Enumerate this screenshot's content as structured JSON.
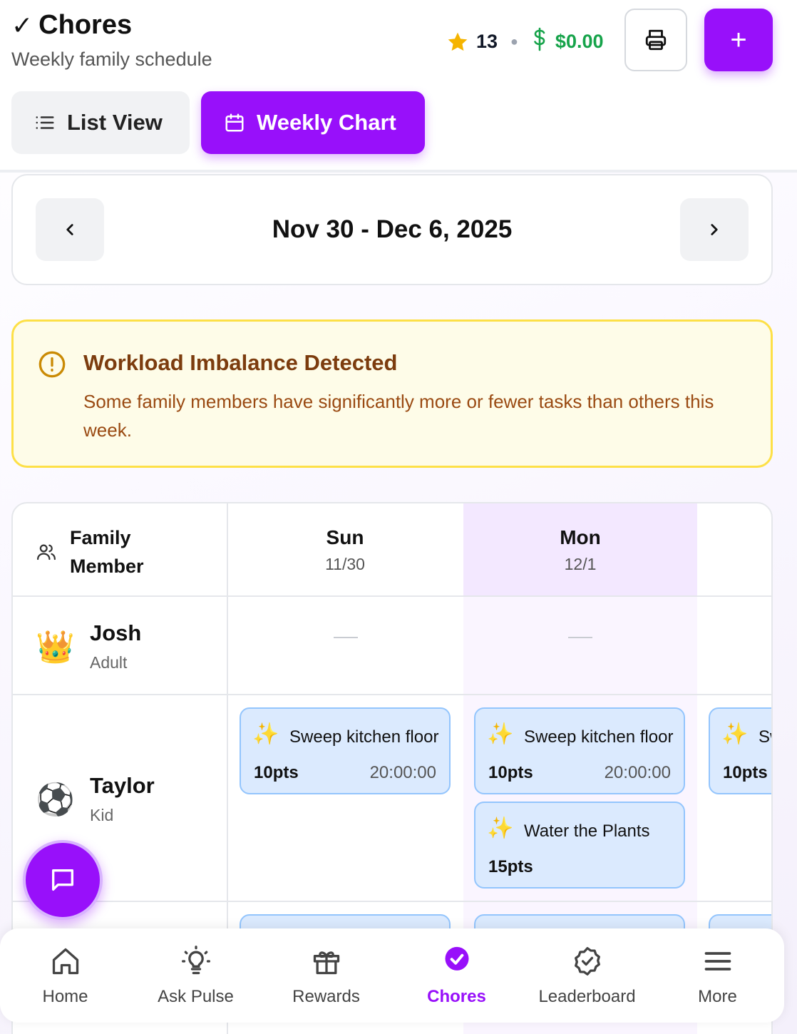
{
  "header": {
    "title": "Chores",
    "title_check": "✓",
    "subtitle": "Weekly family schedule",
    "points": "13",
    "money": "$0.00",
    "add_label": "+"
  },
  "view_toggle": {
    "list_label": "List View",
    "chart_label": "Weekly Chart",
    "active": "Weekly Chart"
  },
  "week": {
    "label": "Nov 30 - Dec 6, 2025"
  },
  "alert": {
    "title": "Workload Imbalance Detected",
    "message": "Some family members have significantly more or fewer tasks than others this week."
  },
  "grid": {
    "member_header": "Family Member",
    "days": [
      {
        "day": "Sun",
        "date": "11/30"
      },
      {
        "day": "Mon",
        "date": "12/1"
      }
    ],
    "members": [
      {
        "name": "Josh",
        "role": "Adult",
        "avatar": "👑"
      },
      {
        "name": "Taylor",
        "role": "Kid",
        "avatar": "⚽"
      }
    ],
    "tasks": {
      "taylor_sun_1": {
        "icon": "✨",
        "name": "Sweep kitchen floor",
        "points": "10pts",
        "time": "20:00:00"
      },
      "taylor_mon_1": {
        "icon": "✨",
        "name": "Sweep kitchen floor",
        "points": "10pts",
        "time": "20:00:00"
      },
      "taylor_mon_2": {
        "icon": "✨",
        "name": "Water the Plants",
        "points": "15pts"
      },
      "taylor_tue_1": {
        "icon": "✨",
        "name": "Sweep kitchen floor",
        "points": "10pts"
      }
    }
  },
  "bottom_nav": [
    {
      "label": "Home",
      "icon": "home-icon"
    },
    {
      "label": "Ask Pulse",
      "icon": "lightbulb-icon"
    },
    {
      "label": "Rewards",
      "icon": "gift-icon"
    },
    {
      "label": "Chores",
      "icon": "check-circle-icon",
      "active": true
    },
    {
      "label": "Leaderboard",
      "icon": "badge-check-icon"
    },
    {
      "label": "More",
      "icon": "menu-icon"
    }
  ],
  "colors": {
    "accent": "#9810fa",
    "money": "#16a34a",
    "alert_bg": "#fefce8",
    "alert_border": "#fde047",
    "task_bg": "#dbeafe",
    "task_border": "#93c5fd"
  }
}
